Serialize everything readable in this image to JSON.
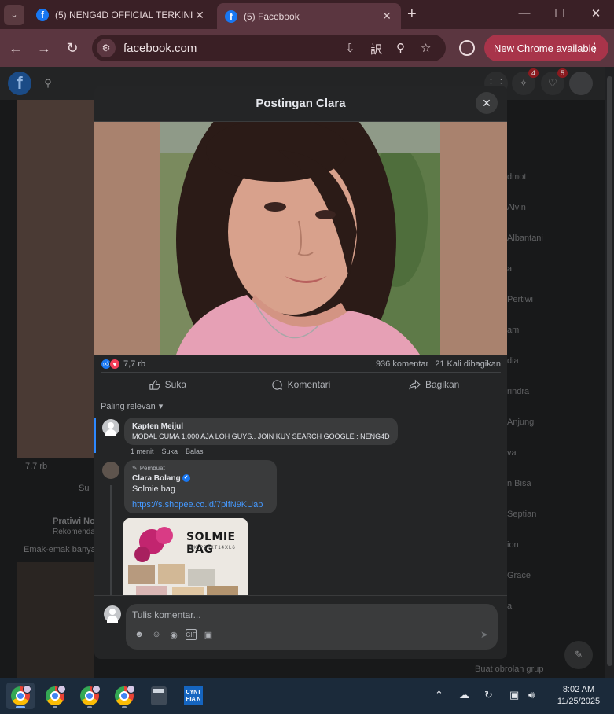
{
  "browser": {
    "tabs": [
      {
        "title": "(5) NENG4D OFFICIAL TERKINI |",
        "favicon": "facebook-icon",
        "active": false
      },
      {
        "title": "(5) Facebook",
        "favicon": "facebook-icon",
        "active": true
      }
    ],
    "url": "facebook.com",
    "update_label": "New Chrome available"
  },
  "facebook": {
    "notifications": {
      "messenger": "4",
      "bell": "5"
    },
    "background_feed": {
      "reactions": "7,7 rb",
      "like_label": "Su",
      "suggested_name": "Pratiwi No",
      "suggested_sub": "Rekomenda",
      "post_text": "Emak-emak banya"
    },
    "contacts": [
      "dmot",
      "Alvin",
      "Albantani",
      "a",
      "Pertiwi",
      "am",
      "dia",
      "rindra",
      "Anjung",
      "va",
      "n Bisa",
      "Septian",
      "ion",
      "Grace",
      "a"
    ],
    "new_group_label": "Buat obrolan grup"
  },
  "modal": {
    "title": "Postingan Clara",
    "stats": {
      "reactions": "7,7 rb",
      "comments": "936 komentar",
      "shares": "21 Kali dibagikan"
    },
    "actions": {
      "like": "Suka",
      "comment": "Komentari",
      "share": "Bagikan"
    },
    "sort_label": "Paling relevan",
    "comments": [
      {
        "author": "Kapten Meijul",
        "text": "MODAL CUMA 1.000 AJA LOH GUYS.. JOIN KUY SEARCH GOOGLE : NENG4D",
        "time": "1 menit",
        "like": "Suka",
        "reply": "Balas"
      },
      {
        "author_tag": "Pembuat",
        "author": "Clara Bolang",
        "text": "Solmie bag",
        "link": "https://s.shopee.co.id/7plfN9KUap",
        "image_title": "SOLMIE BAG",
        "image_sub": "UK P20XT14XL6"
      }
    ],
    "composer_placeholder": "Tulis komentar..."
  },
  "taskbar": {
    "cynthian_label": "CYNT\nHIA N",
    "time": "8:02 AM",
    "date": "11/25/2025"
  }
}
